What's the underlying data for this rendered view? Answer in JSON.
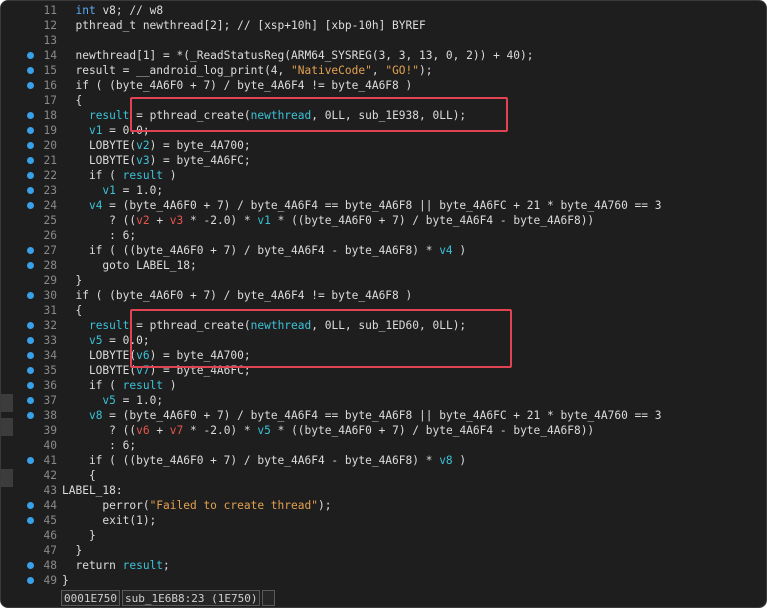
{
  "lines": [
    {
      "n": "11",
      "dot": false,
      "parts": [
        [
          "  ",
          ""
        ],
        [
          "int",
          "kw"
        ],
        [
          " v8; // w8",
          ""
        ]
      ]
    },
    {
      "n": "12",
      "dot": false,
      "parts": [
        [
          "  pthread_t newthread[2]; // [xsp+10h] [xbp-10h] BYREF",
          ""
        ]
      ]
    },
    {
      "n": "13",
      "dot": false,
      "parts": [
        [
          "",
          ""
        ]
      ]
    },
    {
      "n": "14",
      "dot": true,
      "parts": [
        [
          "  newthread[1] = *(_ReadStatusReg(ARM64_SYSREG(3, 3, 13, 0, 2)) + 40);",
          ""
        ]
      ]
    },
    {
      "n": "15",
      "dot": true,
      "parts": [
        [
          "  result = __android_log_print(4, ",
          ""
        ],
        [
          "\"NativeCode\"",
          "str"
        ],
        [
          ", ",
          ""
        ],
        [
          "\"GO!\"",
          "str"
        ],
        [
          ");",
          ""
        ]
      ]
    },
    {
      "n": "16",
      "dot": true,
      "parts": [
        [
          "  if ( (byte_4A6F0 + 7) / byte_4A6F4 != byte_4A6F8 )",
          ""
        ]
      ]
    },
    {
      "n": "17",
      "dot": false,
      "parts": [
        [
          "  {",
          ""
        ]
      ]
    },
    {
      "n": "18",
      "dot": true,
      "parts": [
        [
          "    ",
          ""
        ],
        [
          "result",
          "hl"
        ],
        [
          " = pthread_create(",
          ""
        ],
        [
          "newthread",
          "hl"
        ],
        [
          ", 0LL, sub_1E938, 0LL);",
          ""
        ]
      ]
    },
    {
      "n": "19",
      "dot": true,
      "parts": [
        [
          "    ",
          ""
        ],
        [
          "v1",
          "hl"
        ],
        [
          " = 0.0;",
          ""
        ]
      ]
    },
    {
      "n": "20",
      "dot": true,
      "parts": [
        [
          "    LOBYTE(",
          ""
        ],
        [
          "v2",
          "hl"
        ],
        [
          ") = byte_4A700;",
          ""
        ]
      ]
    },
    {
      "n": "21",
      "dot": true,
      "parts": [
        [
          "    LOBYTE(",
          ""
        ],
        [
          "v3",
          "hl"
        ],
        [
          ") = byte_4A6FC;",
          ""
        ]
      ]
    },
    {
      "n": "22",
      "dot": true,
      "parts": [
        [
          "    if ( ",
          ""
        ],
        [
          "result",
          "hl"
        ],
        [
          " )",
          ""
        ]
      ]
    },
    {
      "n": "23",
      "dot": true,
      "parts": [
        [
          "      ",
          ""
        ],
        [
          "v1",
          "hl"
        ],
        [
          " = 1.0;",
          ""
        ]
      ]
    },
    {
      "n": "24",
      "dot": true,
      "parts": [
        [
          "    ",
          ""
        ],
        [
          "v4",
          "hl"
        ],
        [
          " = (byte_4A6F0 + 7) / byte_4A6F4 == byte_4A6F8 || byte_4A6FC + 21 * byte_4A760 == 3",
          ""
        ]
      ]
    },
    {
      "n": "25",
      "dot": false,
      "parts": [
        [
          "       ? ((",
          ""
        ],
        [
          "v2",
          "red"
        ],
        [
          " + ",
          ""
        ],
        [
          "v3",
          "red"
        ],
        [
          " * -2.0) * ",
          ""
        ],
        [
          "v1",
          "hl"
        ],
        [
          " * ((byte_4A6F0 + 7) / byte_4A6F4 - byte_4A6F8))",
          ""
        ]
      ]
    },
    {
      "n": "26",
      "dot": false,
      "parts": [
        [
          "       : 6;",
          ""
        ]
      ]
    },
    {
      "n": "27",
      "dot": true,
      "parts": [
        [
          "    if ( ((byte_4A6F0 + 7) / byte_4A6F4 - byte_4A6F8) * ",
          ""
        ],
        [
          "v4",
          "hl"
        ],
        [
          " )",
          ""
        ]
      ]
    },
    {
      "n": "28",
      "dot": true,
      "parts": [
        [
          "      goto LABEL_18;",
          ""
        ]
      ]
    },
    {
      "n": "29",
      "dot": false,
      "parts": [
        [
          "  }",
          ""
        ]
      ]
    },
    {
      "n": "30",
      "dot": true,
      "parts": [
        [
          "  if ( (byte_4A6F0 + 7) / byte_4A6F4 != byte_4A6F8 )",
          ""
        ]
      ]
    },
    {
      "n": "31",
      "dot": false,
      "parts": [
        [
          "  {",
          ""
        ]
      ]
    },
    {
      "n": "32",
      "dot": true,
      "parts": [
        [
          "    ",
          ""
        ],
        [
          "result",
          "hl"
        ],
        [
          " = pthread_create(",
          ""
        ],
        [
          "newthread",
          "hl"
        ],
        [
          ", 0LL, sub_1ED60, 0LL);",
          ""
        ]
      ]
    },
    {
      "n": "33",
      "dot": true,
      "parts": [
        [
          "    ",
          ""
        ],
        [
          "v5",
          "hl"
        ],
        [
          " = 0.0;",
          ""
        ]
      ]
    },
    {
      "n": "34",
      "dot": true,
      "parts": [
        [
          "    LOBYTE(",
          ""
        ],
        [
          "v6",
          "hl"
        ],
        [
          ") = byte_4A700;",
          ""
        ]
      ]
    },
    {
      "n": "35",
      "dot": true,
      "parts": [
        [
          "    LOBYTE(",
          ""
        ],
        [
          "v7",
          "hl"
        ],
        [
          ") = byte_4A6FC;",
          ""
        ]
      ]
    },
    {
      "n": "36",
      "dot": true,
      "parts": [
        [
          "    if ( ",
          ""
        ],
        [
          "result",
          "hl"
        ],
        [
          " )",
          ""
        ]
      ]
    },
    {
      "n": "37",
      "dot": true,
      "parts": [
        [
          "      ",
          ""
        ],
        [
          "v5",
          "hl"
        ],
        [
          " = 1.0;",
          ""
        ]
      ]
    },
    {
      "n": "38",
      "dot": true,
      "parts": [
        [
          "    ",
          ""
        ],
        [
          "v8",
          "hl"
        ],
        [
          " = (byte_4A6F0 + 7) / byte_4A6F4 == byte_4A6F8 || byte_4A6FC + 21 * byte_4A760 == 3",
          ""
        ]
      ]
    },
    {
      "n": "39",
      "dot": false,
      "parts": [
        [
          "       ? ((",
          ""
        ],
        [
          "v6",
          "red"
        ],
        [
          " + ",
          ""
        ],
        [
          "v7",
          "red"
        ],
        [
          " * -2.0) * ",
          ""
        ],
        [
          "v5",
          "hl"
        ],
        [
          " * ((byte_4A6F0 + 7) / byte_4A6F4 - byte_4A6F8))",
          ""
        ]
      ]
    },
    {
      "n": "40",
      "dot": false,
      "parts": [
        [
          "       : 6;",
          ""
        ]
      ]
    },
    {
      "n": "41",
      "dot": true,
      "parts": [
        [
          "    if ( ((byte_4A6F0 + 7) / byte_4A6F4 - byte_4A6F8) * ",
          ""
        ],
        [
          "v8",
          "hl"
        ],
        [
          " )",
          ""
        ]
      ]
    },
    {
      "n": "42",
      "dot": false,
      "parts": [
        [
          "    {",
          ""
        ]
      ]
    },
    {
      "n": "43",
      "dot": false,
      "parts": [
        [
          "LABEL_18:",
          ""
        ]
      ]
    },
    {
      "n": "44",
      "dot": true,
      "parts": [
        [
          "      perror(",
          ""
        ],
        [
          "\"Failed to create thread\"",
          "str"
        ],
        [
          ");",
          ""
        ]
      ]
    },
    {
      "n": "45",
      "dot": true,
      "parts": [
        [
          "      exit(1);",
          ""
        ]
      ]
    },
    {
      "n": "46",
      "dot": false,
      "parts": [
        [
          "    }",
          ""
        ]
      ]
    },
    {
      "n": "47",
      "dot": false,
      "parts": [
        [
          "  }",
          ""
        ]
      ]
    },
    {
      "n": "48",
      "dot": true,
      "parts": [
        [
          "  return ",
          ""
        ],
        [
          "result",
          "hl"
        ],
        [
          ";",
          ""
        ]
      ]
    },
    {
      "n": "49",
      "dot": true,
      "parts": [
        [
          "}",
          ""
        ]
      ]
    }
  ],
  "status": {
    "address": "0001E750",
    "location": "sub_1E6B8:23 (1E750)"
  },
  "colors": {
    "background": "#1e1e1e",
    "highlight_box": "#e04352",
    "breakpoint_dot": "#3aa0e8",
    "string": "#e2a150",
    "variable": "#3cc2d8",
    "keyword": "#5aa9f0"
  }
}
